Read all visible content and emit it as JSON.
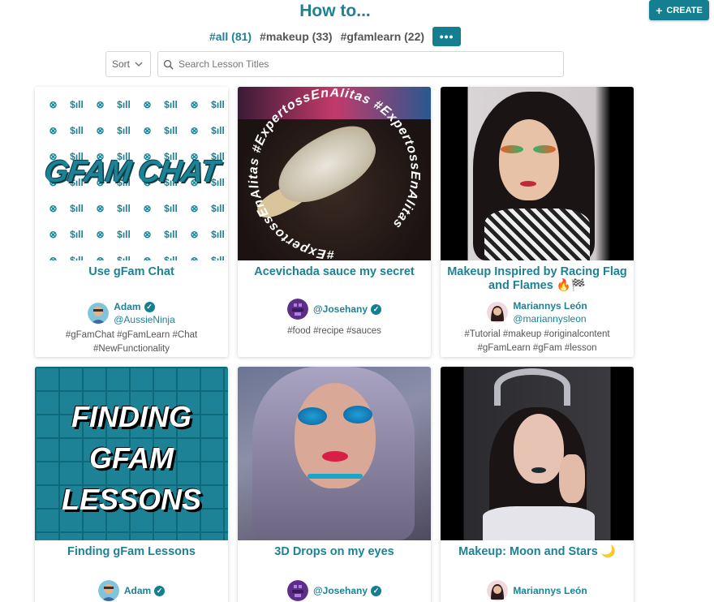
{
  "header": {
    "title": "How to...",
    "create_label": "CREATE"
  },
  "tags": [
    {
      "label": "#all (81)",
      "active": true
    },
    {
      "label": "#makeup (33)",
      "active": false
    },
    {
      "label": "#gfamlearn (22)",
      "active": false
    }
  ],
  "more_label": "•••",
  "sort": {
    "label": "Sort"
  },
  "search": {
    "placeholder": "Search Lesson Titles",
    "value": ""
  },
  "thumb_text": {
    "chat_logo": "GFAM CHAT",
    "chat_pattern_a": "$ıll",
    "sauce_ring": "#ExpertossEnAlitas",
    "lesson_lines": [
      "FINDING",
      "GFAM",
      "LESSONS"
    ]
  },
  "cards": [
    {
      "title": "Use gFam Chat",
      "author": "Adam",
      "handle": "@AussieNinja",
      "tags": "#gFamChat #gFamLearn #Chat #NewFunctionality"
    },
    {
      "title": "Acevichada sauce my secret",
      "author": "@Josehany",
      "handle": "",
      "tags": "#food #recipe #sauces"
    },
    {
      "title": "Makeup Inspired by Racing Flag and Flames 🔥🏁",
      "author": "Mariannys León",
      "handle": "@mariannysleon",
      "tags": "#Tutorial #makeup #originalcontent #gFamLearn #gFam #lesson"
    },
    {
      "title": "Finding gFam Lessons",
      "author": "Adam",
      "handle": "",
      "tags": ""
    },
    {
      "title": "3D Drops on my eyes",
      "author": "@Josehany",
      "handle": "",
      "tags": ""
    },
    {
      "title": "Makeup: Moon and Stars 🌙",
      "author": "Mariannys León",
      "handle": "",
      "tags": ""
    }
  ],
  "colors": {
    "accent": "#1d8296",
    "button": "#157f91"
  }
}
